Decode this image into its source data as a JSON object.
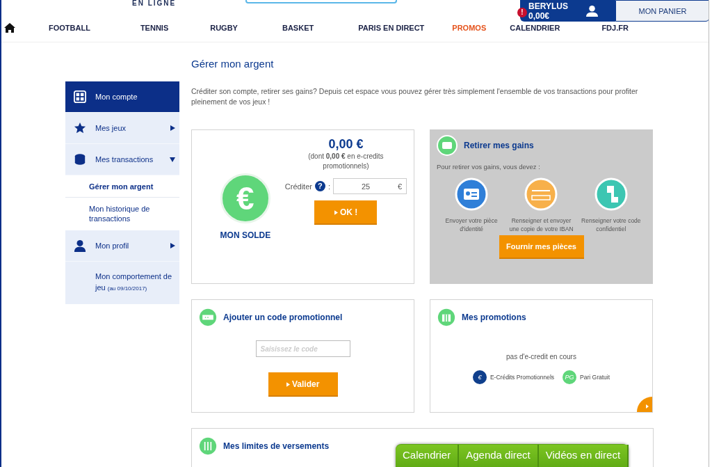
{
  "header": {
    "logo_text": "EN LIGNE",
    "nav": [
      {
        "label": "FOOTBALL",
        "selected": false
      },
      {
        "label": "TENNIS",
        "selected": false
      },
      {
        "label": "RUGBY",
        "selected": false
      },
      {
        "label": "BASKET",
        "selected": false
      },
      {
        "label": "PARIS EN DIRECT",
        "selected": false
      },
      {
        "label": "PROMOS",
        "selected": true
      },
      {
        "label": "CALENDRIER",
        "selected": false
      },
      {
        "label": "FDJ.FR",
        "selected": false
      }
    ],
    "account": {
      "alert": "!",
      "name": "BERYLUS",
      "balance": "0,00€"
    },
    "cart_button": "MON PANIER"
  },
  "sidebar": {
    "items": [
      {
        "kind": "main",
        "label": "Mon compte",
        "selected": true,
        "expanded": false
      },
      {
        "kind": "main",
        "label": "Mes jeux",
        "selected": false,
        "expanded": false
      },
      {
        "kind": "main",
        "label": "Mes transactions",
        "selected": false,
        "expanded": true,
        "children": [
          {
            "label": "Gérer mon argent",
            "selected": true
          },
          {
            "label": "Mon historique de transactions",
            "selected": false
          }
        ]
      },
      {
        "kind": "main",
        "label": "Mon profil",
        "selected": false,
        "expanded": false
      },
      {
        "kind": "note",
        "label": "Mon comportement de jeu",
        "note": "(au 09/10/2017)"
      }
    ]
  },
  "page": {
    "title": "Gérer mon argent",
    "intro": "Créditer son compte, retirer ses gains? Depuis cet espace vous pouvez gérer très simplement l'ensemble de vos transactions pour profiter pleinement de vos jeux !"
  },
  "balance_card": {
    "coin_symbol": "€",
    "label": "MON SOLDE",
    "amount": "0,00 €",
    "detail": "(dont **0,00 €** en e-credits promotionnels)",
    "credit_label": "Créditer",
    "help": "?",
    "separator": ":",
    "credit_value": "25",
    "currency": "€",
    "button": "OK !"
  },
  "withdraw_card": {
    "title": "Retirer mes gains",
    "intro": "Pour retirer vos gains, vous devez :",
    "steps": [
      {
        "kind": "id",
        "text": "Envoyer votre pièce d'identité"
      },
      {
        "kind": "iban",
        "text": "Renseigner et envoyer une copie de votre IBAN"
      },
      {
        "kind": "code",
        "text": "Renseigner votre code confidentiel"
      }
    ],
    "button": "Fournir mes pièces"
  },
  "promo_code_card": {
    "title": "Ajouter un code promotionnel",
    "placeholder": "Saisissez le code",
    "button": "Valider"
  },
  "promotions_card": {
    "title": "Mes promotions",
    "empty": "pas d'e-credit en cours",
    "legend": [
      {
        "badge": "€",
        "label": "E-Crédits Promotionnels",
        "color": "#0f3f8c"
      },
      {
        "badge": "PG",
        "label": "Pari Gratuit",
        "color": "#5fd67a"
      }
    ]
  },
  "limits_card": {
    "title": "Mes limites de versements"
  },
  "bottom_tabs": [
    "Calendrier",
    "Agenda direct",
    "Vidéos en direct"
  ]
}
